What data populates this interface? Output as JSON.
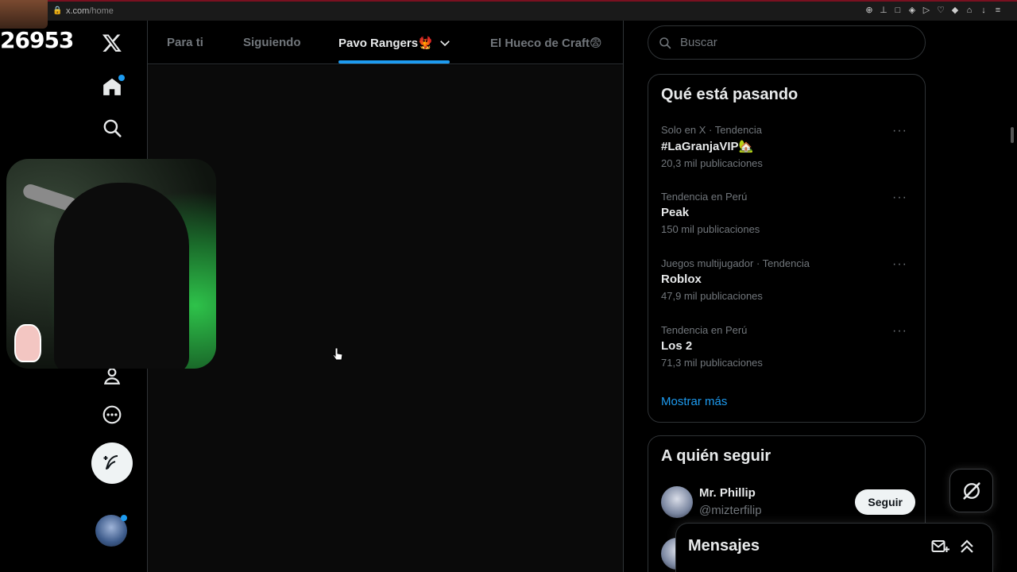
{
  "browser": {
    "url_host": "x.com",
    "url_path": "/home",
    "icons": [
      "zoom-icon",
      "pin-icon",
      "bookmark-icon",
      "shield-icon",
      "play-icon",
      "heart-icon",
      "extension-icon",
      "lock-icon",
      "download-icon",
      "menu-icon"
    ]
  },
  "overlay": {
    "viewer_count": "26953"
  },
  "nav": {
    "items": [
      "x-logo-icon",
      "home-icon",
      "search-icon",
      "profile-icon",
      "more-icon"
    ],
    "post_button_icon": "compose-icon"
  },
  "tabs": [
    {
      "label": "Para ti",
      "active": false
    },
    {
      "label": "Siguiendo",
      "active": false
    },
    {
      "label": "Pavo Rangers🐦‍🔥",
      "active": true
    },
    {
      "label": "El Hueco de Craft😨",
      "active": false
    }
  ],
  "search": {
    "placeholder": "Buscar"
  },
  "trends": {
    "title": "Qué está pasando",
    "items": [
      {
        "meta": "Solo en X · Tendencia",
        "name": "#LaGranjaVIP🏡",
        "count": "20,3 mil publicaciones"
      },
      {
        "meta": "Tendencia en Perú",
        "name": "Peak",
        "count": "150 mil publicaciones"
      },
      {
        "meta": "Juegos multijugador · Tendencia",
        "name": "Roblox",
        "count": "47,9 mil publicaciones"
      },
      {
        "meta": "Tendencia en Perú",
        "name": "Los 2",
        "count": "71,3 mil publicaciones"
      }
    ],
    "more_label": "···",
    "show_more": "Mostrar más"
  },
  "who_to_follow": {
    "title": "A quién seguir",
    "users": [
      {
        "name": "Mr. Phillip",
        "handle": "@mizterfilip",
        "button": "Seguir"
      }
    ]
  },
  "messages": {
    "title": "Mensajes"
  },
  "colors": {
    "accent": "#1d9bf0",
    "background": "#000000",
    "border": "#2f3336",
    "muted_text": "#71767b"
  }
}
